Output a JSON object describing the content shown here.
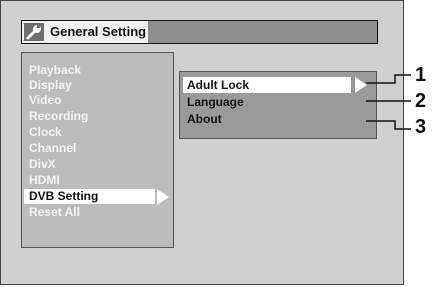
{
  "window": {
    "title": "General Setting",
    "title_icon": "wrench-icon"
  },
  "menu": {
    "items": [
      {
        "label": "Playback"
      },
      {
        "label": "Display"
      },
      {
        "label": "Video"
      },
      {
        "label": "Recording"
      },
      {
        "label": "Clock"
      },
      {
        "label": "Channel"
      },
      {
        "label": "DivX"
      },
      {
        "label": "HDMI"
      },
      {
        "label": "DVB Setting",
        "selected": true
      },
      {
        "label": "Reset All"
      }
    ]
  },
  "submenu": {
    "items": [
      {
        "label": "Adult Lock",
        "selected": true
      },
      {
        "label": "Language"
      },
      {
        "label": "About"
      }
    ]
  },
  "callouts": [
    "1",
    "2",
    "3"
  ]
}
